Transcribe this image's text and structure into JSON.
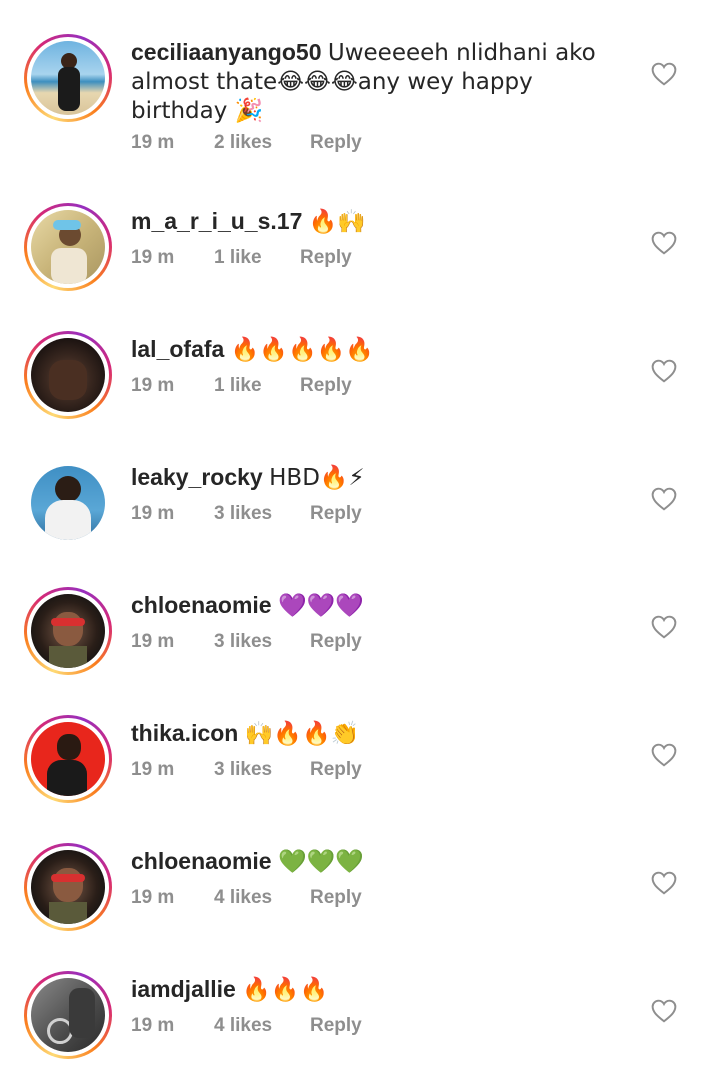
{
  "comments": [
    {
      "username": "ceciliaanyango50",
      "text": "Uweeeeeh nlidhani ako almost thate😂😂😂any wey happy birthday 🎉",
      "time": "19 m",
      "likes": "2 likes",
      "reply": "Reply",
      "ring": true
    },
    {
      "username": "m_a_r_i_u_s.17",
      "text": "🔥🙌",
      "time": "19 m",
      "likes": "1 like",
      "reply": "Reply",
      "ring": true
    },
    {
      "username": "lal_ofafa",
      "text": "🔥🔥🔥🔥🔥",
      "time": "19 m",
      "likes": "1 like",
      "reply": "Reply",
      "ring": true
    },
    {
      "username": "leaky_rocky",
      "text": "HBD🔥⚡",
      "time": "19 m",
      "likes": "3 likes",
      "reply": "Reply",
      "ring": false
    },
    {
      "username": "chloenaomie",
      "text": "💜💜💜",
      "time": "19 m",
      "likes": "3 likes",
      "reply": "Reply",
      "ring": true
    },
    {
      "username": "thika.icon",
      "text": "🙌🔥🔥👏",
      "time": "19 m",
      "likes": "3 likes",
      "reply": "Reply",
      "ring": true
    },
    {
      "username": "chloenaomie",
      "text": "💚💚💚",
      "time": "19 m",
      "likes": "4 likes",
      "reply": "Reply",
      "ring": true
    },
    {
      "username": "iamdjallie",
      "text": "🔥🔥🔥",
      "time": "19 m",
      "likes": "4 likes",
      "reply": "Reply",
      "ring": true
    }
  ],
  "icons": {
    "like": "heart-outline-icon"
  }
}
